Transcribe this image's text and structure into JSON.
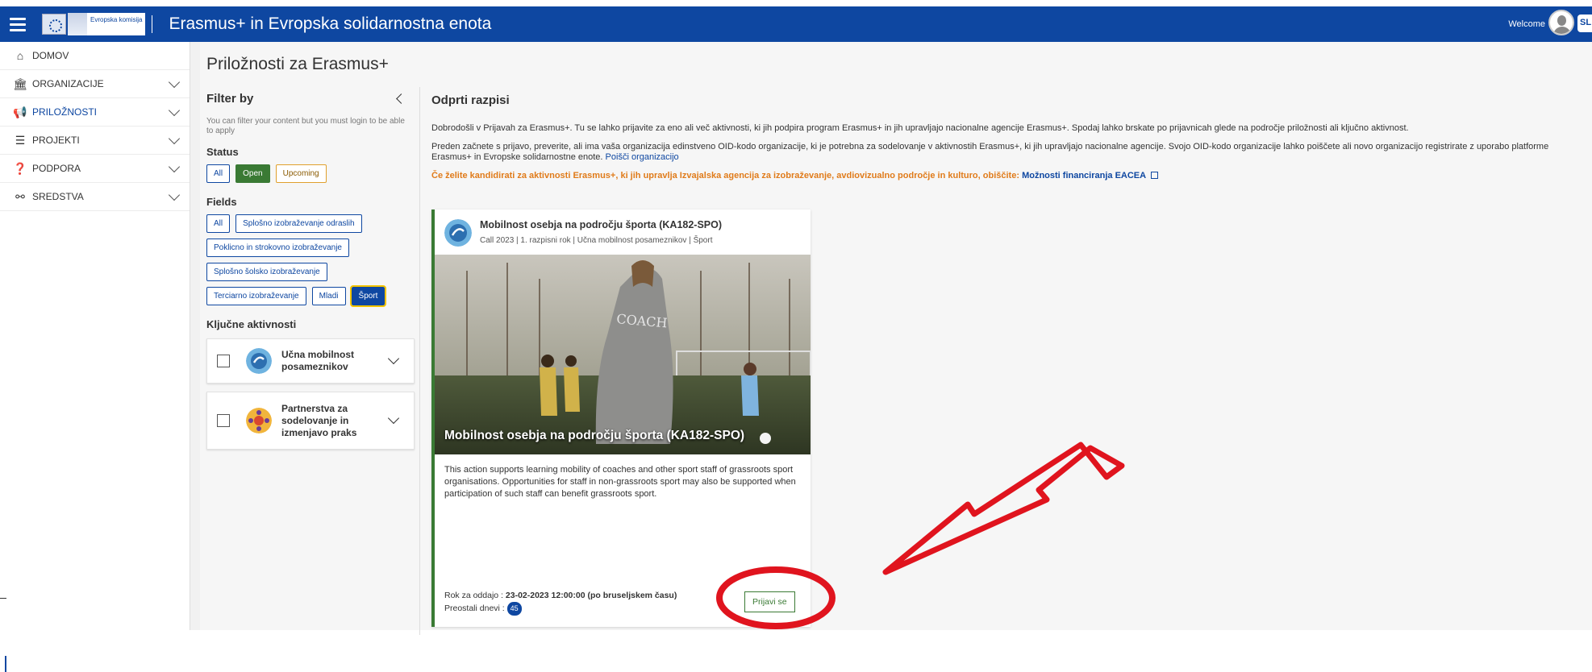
{
  "header": {
    "logo_text": "Evropska komisija",
    "title": "Erasmus+ in Evropska solidarnostna enota",
    "welcome": "Welcome",
    "lang": "SL",
    "bg_color": "#0e47a1"
  },
  "sidebar": {
    "items": [
      {
        "label": "DOMOV",
        "icon": "home-icon",
        "glyph": "⌂"
      },
      {
        "label": "ORGANIZACIJE",
        "icon": "institution-icon",
        "glyph": "🏛"
      },
      {
        "label": "PRILOŽNOSTI",
        "icon": "megaphone-icon",
        "glyph": "📢",
        "active": true
      },
      {
        "label": "PROJEKTI",
        "icon": "projects-icon",
        "glyph": "☰"
      },
      {
        "label": "PODPORA",
        "icon": "question-icon",
        "glyph": "❓"
      },
      {
        "label": "SREDSTVA",
        "icon": "link-icon",
        "glyph": "⚯"
      }
    ]
  },
  "page": {
    "title": "Priložnosti za Erasmus+"
  },
  "filter": {
    "title": "Filter by",
    "note": "You can filter your content but you must login to be able to apply",
    "status_label": "Status",
    "status_chips": [
      "All",
      "Open",
      "Upcoming"
    ],
    "fields_label": "Fields",
    "field_chips": [
      "All",
      "Splošno izobraževanje odraslih",
      "Poklicno in strokovno izobraževanje",
      "Splošno šolsko izobraževanje",
      "Terciarno izobraževanje",
      "Mladi",
      "Šport"
    ],
    "key_actions_label": "Ključne aktivnosti",
    "key_actions": [
      {
        "label": "Učna mobilnost posameznikov"
      },
      {
        "label": "Partnerstva za sodelovanje in izmenjavo praks"
      }
    ]
  },
  "content": {
    "title": "Odprti razpisi",
    "intro": "Dobrodošli v Prijavah za Erasmus+. Tu se lahko prijavite za eno ali več aktivnosti, ki jih podpira program Erasmus+ in jih upravljajo nacionalne agencije Erasmus+. Spodaj lahko brskate po prijavnicah glede na področje priložnosti ali ključno aktivnost.",
    "oid_text": "Preden začnete s prijavo, preverite, ali ima vaša organizacija edinstveno OID-kodo organizacije, ki je potrebna za sodelovanje v aktivnostih Erasmus+, ki jih upravljajo nacionalne agencije. Svojo OID-kodo organizacije lahko poiščete ali novo organizacijo registrirate z uporabo platforme Erasmus+ in Evropske solidarnostne enote.",
    "oid_link": "Poišči organizacijo",
    "eacea_text": "Če želite kandidirati za aktivnosti Erasmus+, ki jih upravlja Izvajalska agencija za izobraževanje, avdiovizualno področje in kulturo, obiščite:",
    "eacea_link": "Možnosti financiranja EACEA"
  },
  "card": {
    "title": "Mobilnost osebja na področju športa (KA182-SPO)",
    "subtitle": "Call 2023 | 1. razpisni rok | Učna mobilnost posameznikov | Šport",
    "image_title": "Mobilnost osebja na področju športa (KA182-SPO)",
    "image_jacket_text": "COACH",
    "description": "This action supports learning mobility of coaches and other sport staff of grassroots sport organisations. Opportunities for staff in non-grassroots sport may also be supported when participation of such staff can benefit grassroots sport.",
    "deadline_label": "Rok za oddajo :",
    "deadline_value": "23-02-2023 12:00:00 (po bruseljskem času)",
    "days_label": "Preostali dnevi :",
    "days_value": "45",
    "apply_label": "Prijavi se"
  },
  "annotation": {
    "color": "#e0141e"
  }
}
